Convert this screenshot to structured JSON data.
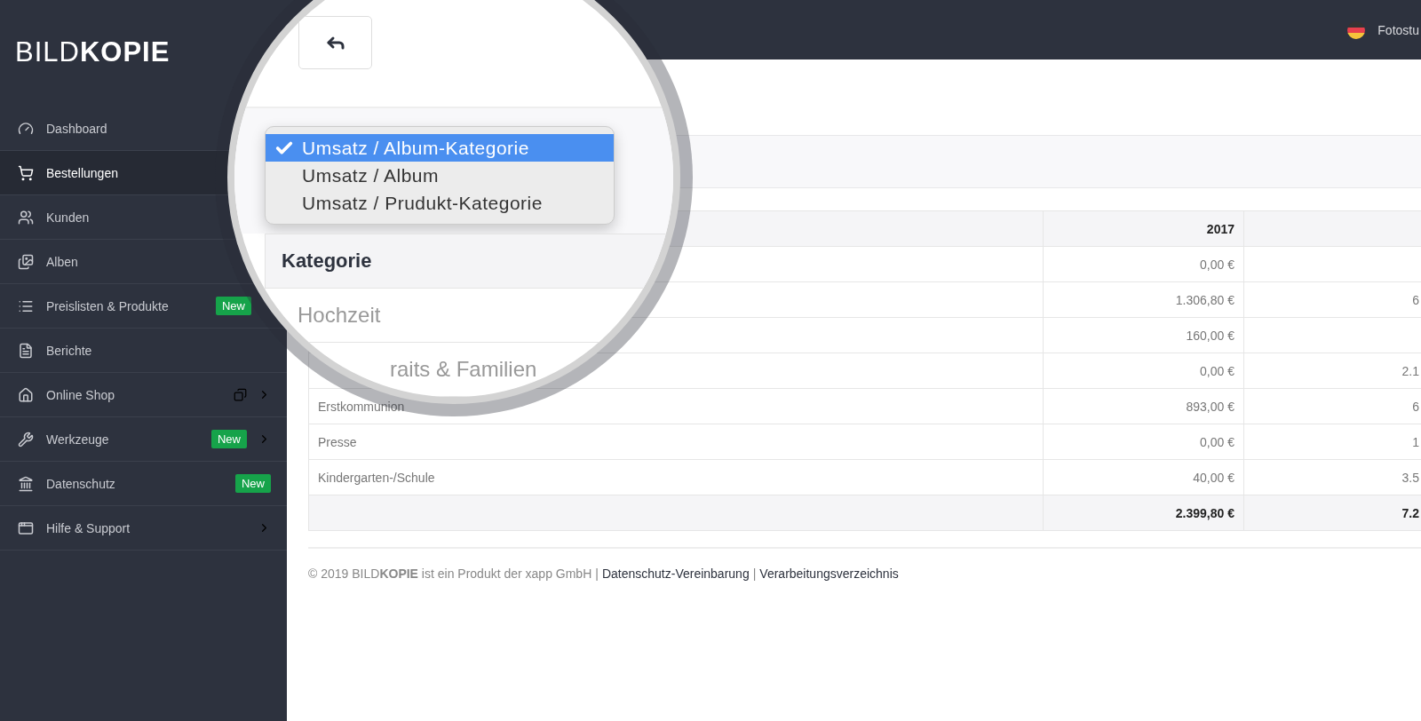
{
  "logo": "BILD**KOPIE**",
  "nav": {
    "items": [
      {
        "label": "Dashboard",
        "selected": false
      },
      {
        "label": "Bestellungen",
        "selected": true
      },
      {
        "label": "Kunden",
        "selected": false
      },
      {
        "label": "Alben",
        "selected": false
      },
      {
        "label": "Preislisten & Produkte",
        "selected": false,
        "badge": "New"
      },
      {
        "label": "Berichte",
        "selected": false
      },
      {
        "label": "Online Shop",
        "selected": false,
        "popout": true,
        "chevron": true
      },
      {
        "label": "Werkzeuge",
        "selected": false,
        "badge": "New",
        "chevron": true
      },
      {
        "label": "Datenschutz",
        "selected": false,
        "badge": "New"
      },
      {
        "label": "Hilfe & Support",
        "selected": false,
        "chevron": true
      }
    ]
  },
  "topbar": {
    "user": "Fotostu"
  },
  "table": {
    "columns": [
      "",
      "2017",
      ""
    ],
    "rows": [
      {
        "col_2017": "0,00 €"
      },
      {
        "col_2017": "1.306,80 €",
        "column_3": "6"
      },
      {
        "col_2017": "160,00 €"
      },
      {
        "col_2017": "0,00 €",
        "column_3": "2.1"
      },
      {
        "name": "Erstkommunion",
        "col_2017": "893,00 €",
        "column_3": "6"
      },
      {
        "name": "Presse",
        "col_2017": "0,00 €",
        "column_3": "1"
      },
      {
        "name": "Kindergarten-/Schule",
        "col_2017": "40,00 €",
        "column_3": "3.5"
      }
    ],
    "total": {
      "col_2017": "2.399,80 €",
      "column_3": "7.2"
    }
  },
  "footer": [
    {
      "kind": "text",
      "text": "© 2019 BILD**KOPIE** ist ein Produkt der xapp GmbH"
    },
    {
      "kind": "separator",
      "text": "|"
    },
    {
      "kind": "link",
      "text": "Datenschutz-Vereinbarung"
    },
    {
      "kind": "separator",
      "text": "|"
    },
    {
      "kind": "link",
      "text": "Verarbeitungsverzeichnis"
    }
  ],
  "magnifier": {
    "dropdown": {
      "options": [
        {
          "label": "Umsatz / Album-Kategorie",
          "selected": true
        },
        {
          "label": "Umsatz / Album",
          "selected": false
        },
        {
          "label": "Umsatz / Prudukt-Kategorie",
          "selected": false
        }
      ]
    },
    "table_header": "Kategorie",
    "rows": [
      "Hochzeit",
      "raits & Familien"
    ]
  }
}
